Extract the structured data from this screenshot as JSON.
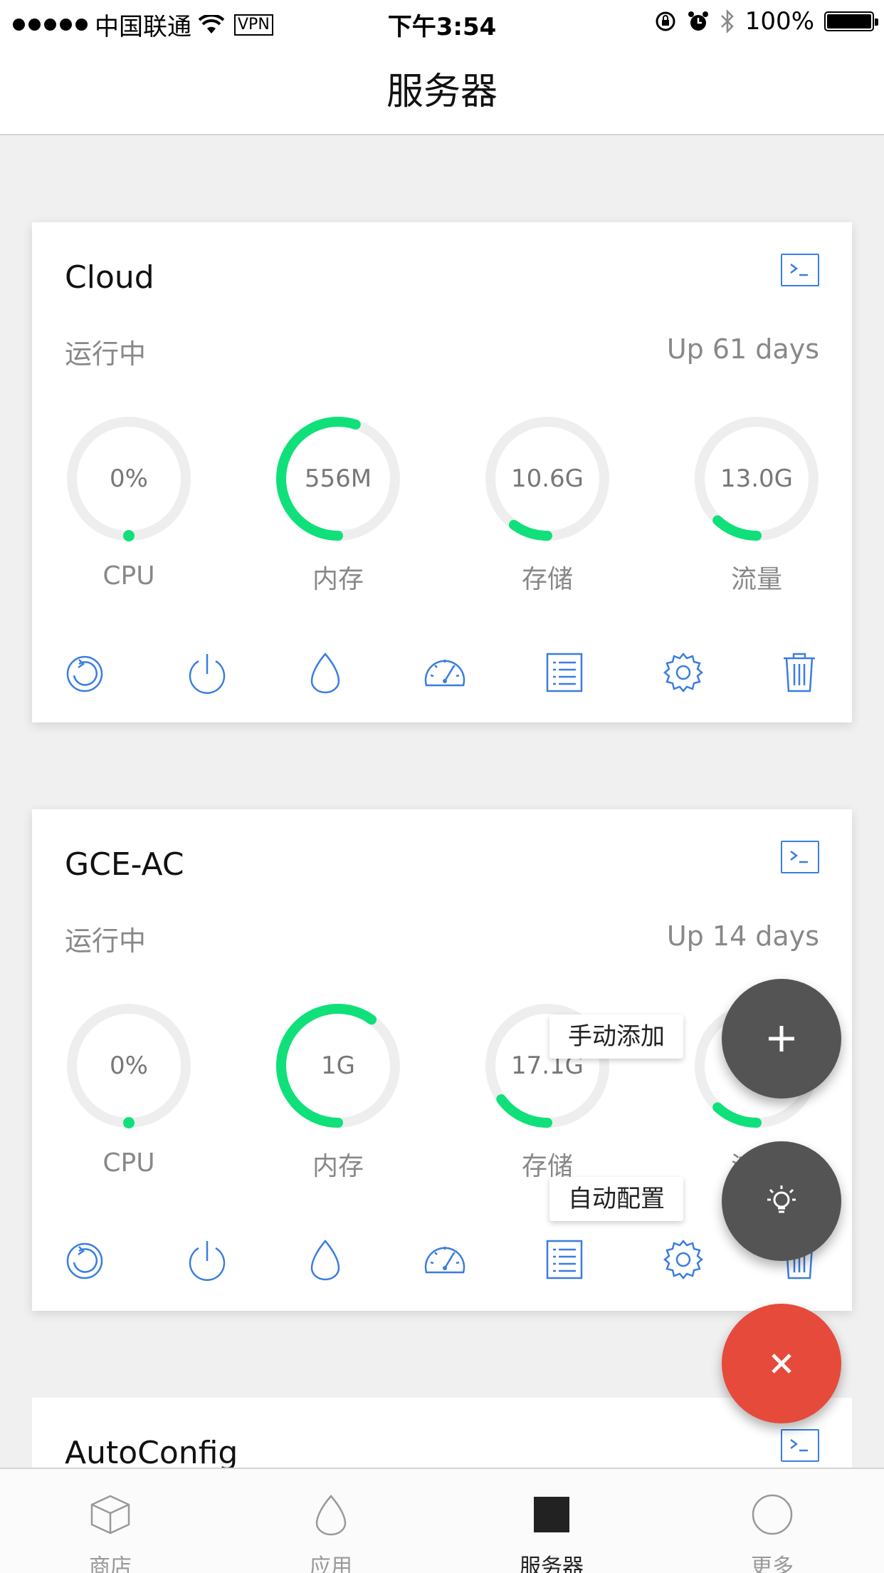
{
  "status_bar": {
    "carrier": "中国联通",
    "vpn": "VPN",
    "time": "下午3:54",
    "battery": "100%"
  },
  "nav": {
    "title": "服务器"
  },
  "servers": [
    {
      "name": "Cloud",
      "status": "运行中",
      "uptime": "Up 61 days",
      "gauges": [
        {
          "value": "0%",
          "label": "CPU",
          "fraction": 0.0
        },
        {
          "value": "556M",
          "label": "内存",
          "fraction": 0.55
        },
        {
          "value": "10.6G",
          "label": "存储",
          "fraction": 0.1
        },
        {
          "value": "13.0G",
          "label": "流量",
          "fraction": 0.12
        }
      ]
    },
    {
      "name": "GCE-AC",
      "status": "运行中",
      "uptime": "Up 14 days",
      "gauges": [
        {
          "value": "0%",
          "label": "CPU",
          "fraction": 0.0
        },
        {
          "value": "1G",
          "label": "内存",
          "fraction": 0.6
        },
        {
          "value": "17.1G",
          "label": "存储",
          "fraction": 0.15
        },
        {
          "value": "",
          "label": "流量",
          "fraction": 0.12
        }
      ]
    },
    {
      "name": "AutoConfig"
    }
  ],
  "actions": [
    "refresh-icon",
    "power-icon",
    "egg-icon",
    "speedometer-icon",
    "list-icon",
    "settings-icon",
    "trash-icon"
  ],
  "fab": {
    "manual_add": "手动添加",
    "auto_config": "自动配置",
    "plus_icon": "plus-icon",
    "bulb_icon": "lightbulb-icon",
    "close_icon": "close-icon"
  },
  "tabs": [
    {
      "label": "商店",
      "icon": "box-icon",
      "active": false
    },
    {
      "label": "应用",
      "icon": "egg-icon",
      "active": false
    },
    {
      "label": "服务器",
      "icon": "square-icon",
      "active": true
    },
    {
      "label": "更多",
      "icon": "circle-icon",
      "active": false
    }
  ],
  "colors": {
    "accent": "#3a7de0",
    "gauge_fill": "#10e07a",
    "gauge_track": "#eeeeee",
    "fab_dark": "#545454",
    "fab_close": "#e64a3b"
  }
}
